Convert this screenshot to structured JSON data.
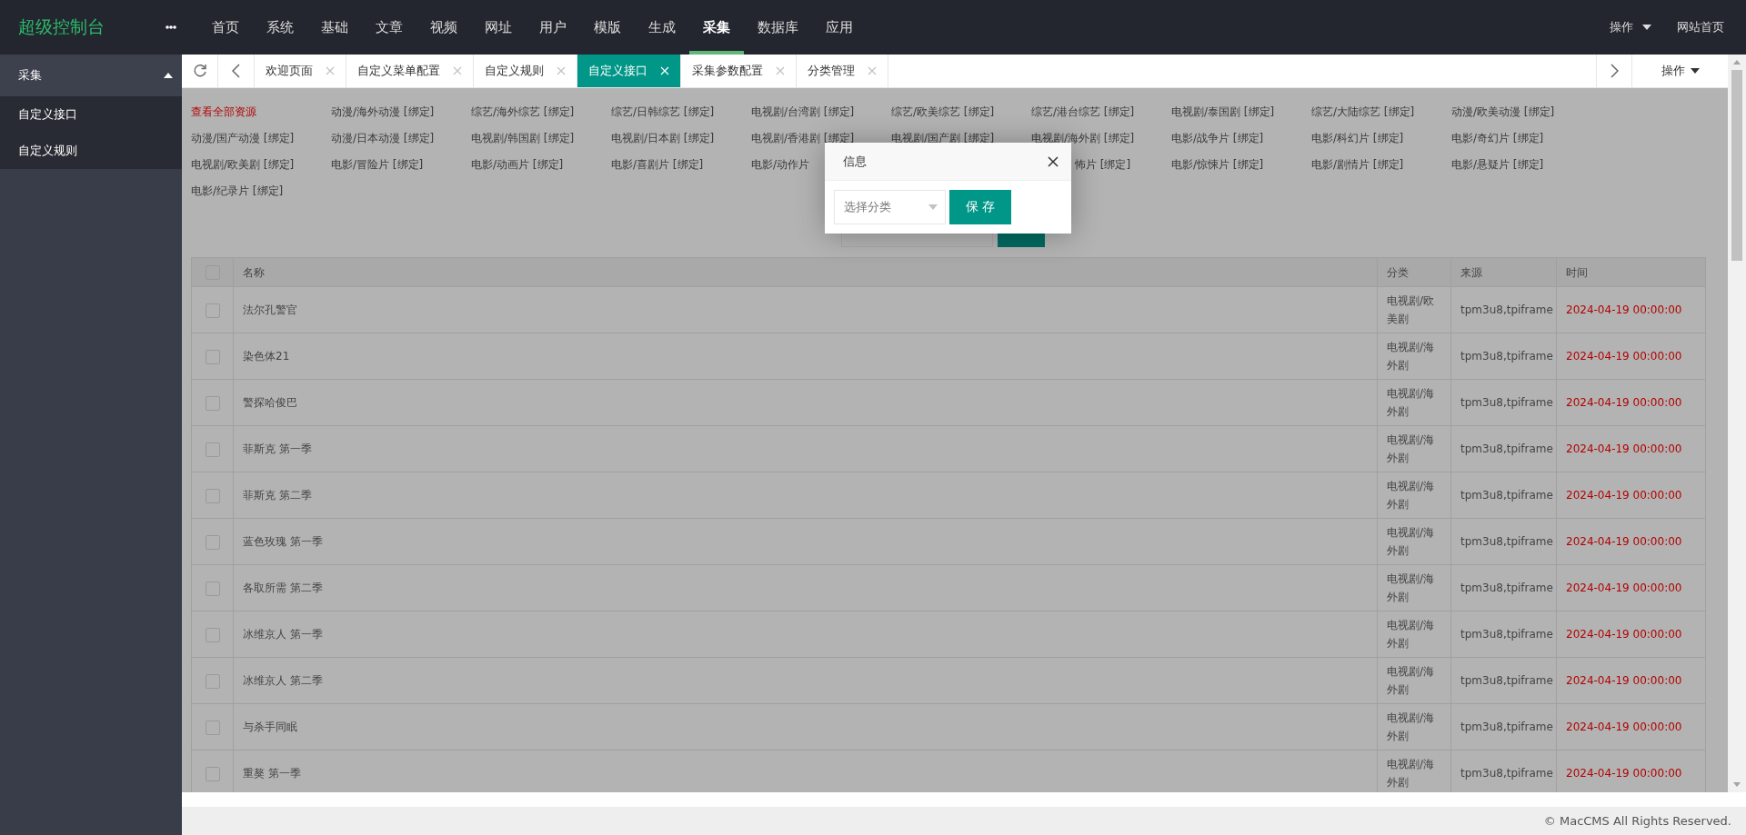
{
  "header": {
    "logo": "超级控制台",
    "nav": [
      {
        "label": "首页",
        "selected": false
      },
      {
        "label": "系统",
        "selected": false
      },
      {
        "label": "基础",
        "selected": false
      },
      {
        "label": "文章",
        "selected": false
      },
      {
        "label": "视频",
        "selected": false
      },
      {
        "label": "网址",
        "selected": false
      },
      {
        "label": "用户",
        "selected": false
      },
      {
        "label": "模版",
        "selected": false
      },
      {
        "label": "生成",
        "selected": false
      },
      {
        "label": "采集",
        "selected": true
      },
      {
        "label": "数据库",
        "selected": false
      },
      {
        "label": "应用",
        "selected": false
      }
    ],
    "actions": "操作",
    "home_link": "网站首页"
  },
  "sidebar": {
    "group": "采集",
    "expanded": true,
    "items": [
      {
        "label": "自定义接口",
        "selected": false
      },
      {
        "label": "自定义规则",
        "selected": false
      }
    ]
  },
  "tabs": [
    {
      "label": "欢迎页面",
      "selected": false
    },
    {
      "label": "自定义菜单配置",
      "selected": false
    },
    {
      "label": "自定义规则",
      "selected": false
    },
    {
      "label": "自定义接口",
      "selected": true
    },
    {
      "label": "采集参数配置",
      "selected": false
    },
    {
      "label": "分类管理",
      "selected": false
    }
  ],
  "tab_actions": "操作",
  "links": [
    {
      "text": "查看全部资源",
      "kind": "all"
    },
    {
      "text": "动漫/海外动漫 [绑定]",
      "kind": "bind"
    },
    {
      "text": "综艺/海外综艺 [绑定]",
      "kind": "bind"
    },
    {
      "text": "综艺/日韩综艺 [绑定]",
      "kind": "bind"
    },
    {
      "text": "电视剧/台湾剧 [绑定]",
      "kind": "bind"
    },
    {
      "text": "综艺/欧美综艺 [绑定]",
      "kind": "bind"
    },
    {
      "text": "综艺/港台综艺 [绑定]",
      "kind": "bind"
    },
    {
      "text": "电视剧/泰国剧 [绑定]",
      "kind": "bind"
    },
    {
      "text": "综艺/大陆综艺 [绑定]",
      "kind": "bind"
    },
    {
      "text": "动漫/欧美动漫 [绑定]",
      "kind": "bind"
    },
    {
      "text": "动漫/国产动漫 [绑定]",
      "kind": "bind"
    },
    {
      "text": "动漫/日本动漫 [绑定]",
      "kind": "bind"
    },
    {
      "text": "电视剧/韩国剧 [绑定]",
      "kind": "bind"
    },
    {
      "text": "电视剧/日本剧 [绑定]",
      "kind": "bind"
    },
    {
      "text": "电视剧/香港剧 [绑定]",
      "kind": "bind"
    },
    {
      "text": "电视剧/国产剧 [绑定]",
      "kind": "bind"
    },
    {
      "text": "电视剧/海外剧 [绑定]",
      "kind": "bind"
    },
    {
      "text": "电影/战争片 [绑定]",
      "kind": "bind"
    },
    {
      "text": "电影/科幻片 [绑定]",
      "kind": "bind"
    },
    {
      "text": "电影/奇幻片 [绑定]",
      "kind": "bind"
    },
    {
      "text": "电视剧/欧美剧 [绑定]",
      "kind": "bind"
    },
    {
      "text": "电影/冒险片 [绑定]",
      "kind": "bind"
    },
    {
      "text": "电影/动画片 [绑定]",
      "kind": "bind"
    },
    {
      "text": "电影/喜剧片 [绑定]",
      "kind": "bind"
    },
    {
      "text": "电影/动作片",
      "kind": "bind"
    },
    {
      "text": "怖片 [绑定]",
      "kind": "tail"
    },
    {
      "text": "电影/惊悚片 [绑定]",
      "kind": "bind"
    },
    {
      "text": "电影/剧情片 [绑定]",
      "kind": "bind"
    },
    {
      "text": "电影/悬疑片 [绑定]",
      "kind": "bind"
    },
    {
      "text": "电影/纪录片 [绑定]",
      "kind": "bind"
    }
  ],
  "dialog": {
    "title": "信息",
    "select_placeholder": "选择分类",
    "button": "保 存"
  },
  "table": {
    "header_checked": false,
    "columns": [
      "名称",
      "分类",
      "来源",
      "时间"
    ],
    "rows": [
      {
        "checked": false,
        "name": "法尔孔警官",
        "category": "电视剧/欧美剧",
        "source": "tpm3u8,tpiframe",
        "time": "2024-04-19 00:00:00"
      },
      {
        "checked": false,
        "name": "染色体21",
        "category": "电视剧/海外剧",
        "source": "tpm3u8,tpiframe",
        "time": "2024-04-19 00:00:00"
      },
      {
        "checked": false,
        "name": "警探哈俊巴",
        "category": "电视剧/海外剧",
        "source": "tpm3u8,tpiframe",
        "time": "2024-04-19 00:00:00"
      },
      {
        "checked": false,
        "name": "菲斯克 第一季",
        "category": "电视剧/海外剧",
        "source": "tpm3u8,tpiframe",
        "time": "2024-04-19 00:00:00"
      },
      {
        "checked": false,
        "name": "菲斯克 第二季",
        "category": "电视剧/海外剧",
        "source": "tpm3u8,tpiframe",
        "time": "2024-04-19 00:00:00"
      },
      {
        "checked": false,
        "name": "蓝色玫瑰 第一季",
        "category": "电视剧/海外剧",
        "source": "tpm3u8,tpiframe",
        "time": "2024-04-19 00:00:00"
      },
      {
        "checked": false,
        "name": "各取所需 第二季",
        "category": "电视剧/海外剧",
        "source": "tpm3u8,tpiframe",
        "time": "2024-04-19 00:00:00"
      },
      {
        "checked": false,
        "name": "冰维京人 第一季",
        "category": "电视剧/海外剧",
        "source": "tpm3u8,tpiframe",
        "time": "2024-04-19 00:00:00"
      },
      {
        "checked": false,
        "name": "冰维京人 第二季",
        "category": "电视剧/海外剧",
        "source": "tpm3u8,tpiframe",
        "time": "2024-04-19 00:00:00"
      },
      {
        "checked": false,
        "name": "与杀手同眠",
        "category": "电视剧/海外剧",
        "source": "tpm3u8,tpiframe",
        "time": "2024-04-19 00:00:00"
      },
      {
        "checked": false,
        "name": "重獒 第一季",
        "category": "电视剧/海外剧",
        "source": "tpm3u8,tpiframe",
        "time": "2024-04-19 00:00:00"
      }
    ]
  },
  "footer": "© MacCMS All Rights Reserved."
}
